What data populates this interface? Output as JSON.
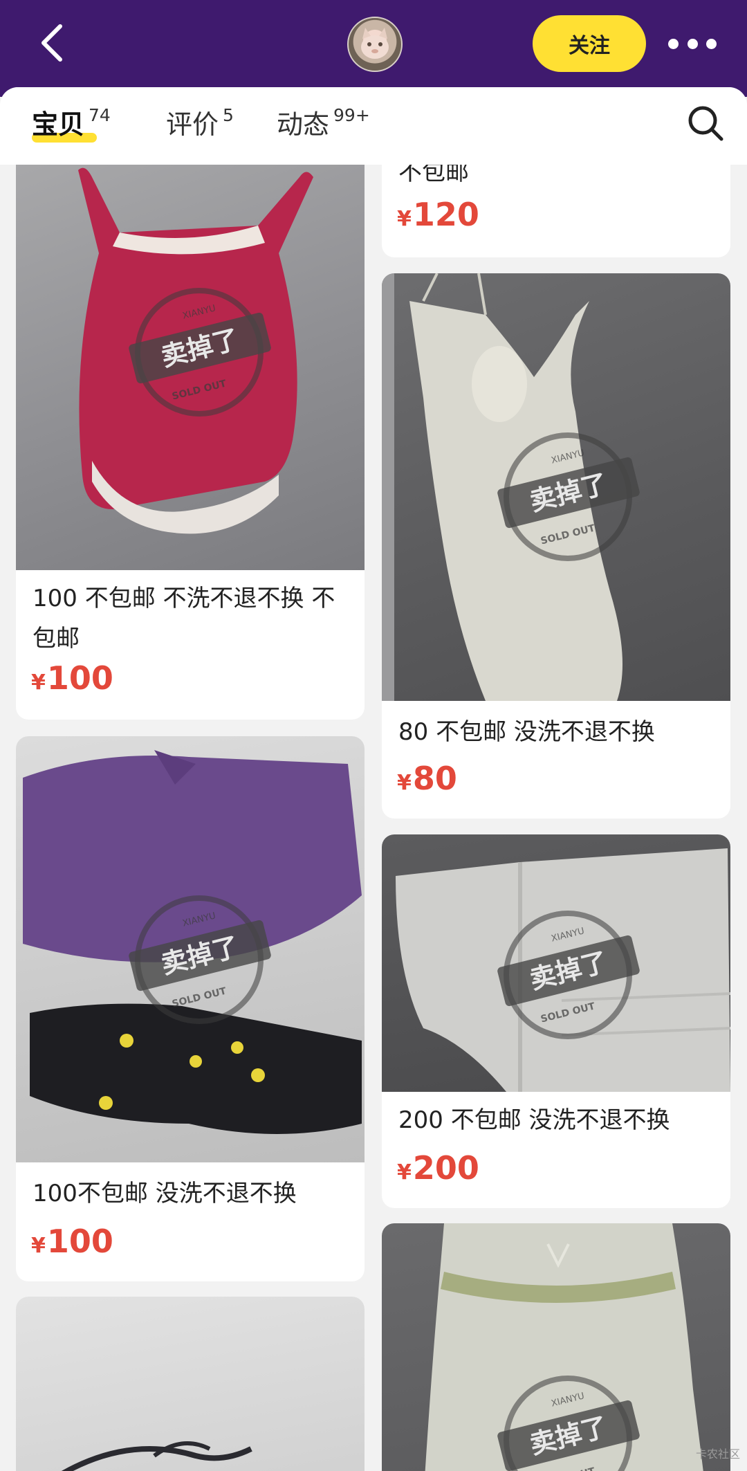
{
  "header": {
    "follow_label": "关注",
    "icons": [
      "back-arrow-icon",
      "more-dots-icon",
      "search-icon"
    ],
    "colors": {
      "bar": "#3f1a6e",
      "accent": "#ffe033",
      "price": "#e3483a"
    }
  },
  "tabs": [
    {
      "label": "宝贝",
      "count": "74"
    },
    {
      "label": "评价",
      "count": "5"
    },
    {
      "label": "动态",
      "count": "99+"
    }
  ],
  "stamp": {
    "main": "卖掉了",
    "top": "XIANYU",
    "bottom": "SOLD OUT"
  },
  "products": {
    "left": [
      {
        "title": "100 不包邮 不洗不退不换 不包邮",
        "currency": "¥",
        "price": "100"
      },
      {
        "title": "100不包邮 没洗不退不换",
        "currency": "¥",
        "price": "100"
      }
    ],
    "right": [
      {
        "title": "不包邮",
        "currency": "¥",
        "price": "120"
      },
      {
        "title": "80 不包邮 没洗不退不换",
        "currency": "¥",
        "price": "80"
      },
      {
        "title": "200 不包邮 没洗不退不换",
        "currency": "¥",
        "price": "200"
      }
    ]
  },
  "watermark": "卡农社区"
}
